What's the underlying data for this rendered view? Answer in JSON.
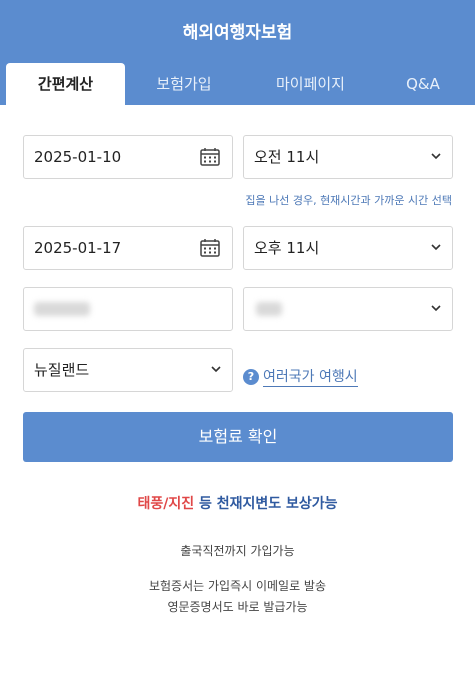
{
  "header": {
    "title": "해외여행자보험"
  },
  "tabs": [
    {
      "label": "간편계산"
    },
    {
      "label": "보험가입"
    },
    {
      "label": "마이페이지"
    },
    {
      "label": "Q&A"
    }
  ],
  "form": {
    "start_date": "2025-01-10",
    "start_time": "오전 11시",
    "hint": "집을 나선 경우, 현재시간과 가까운 시간 선택",
    "end_date": "2025-01-17",
    "end_time": "오후 11시",
    "country": "뉴질랜드",
    "multi_country_link": "여러국가 여행시",
    "multi_country_icon": "?"
  },
  "button": {
    "label": "보험료 확인"
  },
  "promo": {
    "red_text": "태풍/지진",
    "blue_text": " 등 천재지변도 보상가능"
  },
  "notes": {
    "line1": "출국직전까지 가입가능",
    "line2": "보험증서는 가입즉시 이메일로 발송",
    "line3": "영문증명서도 바로 발급가능"
  },
  "colors": {
    "primary": "#5b8ccf",
    "link": "#4e79b7",
    "alert": "#e04848"
  }
}
